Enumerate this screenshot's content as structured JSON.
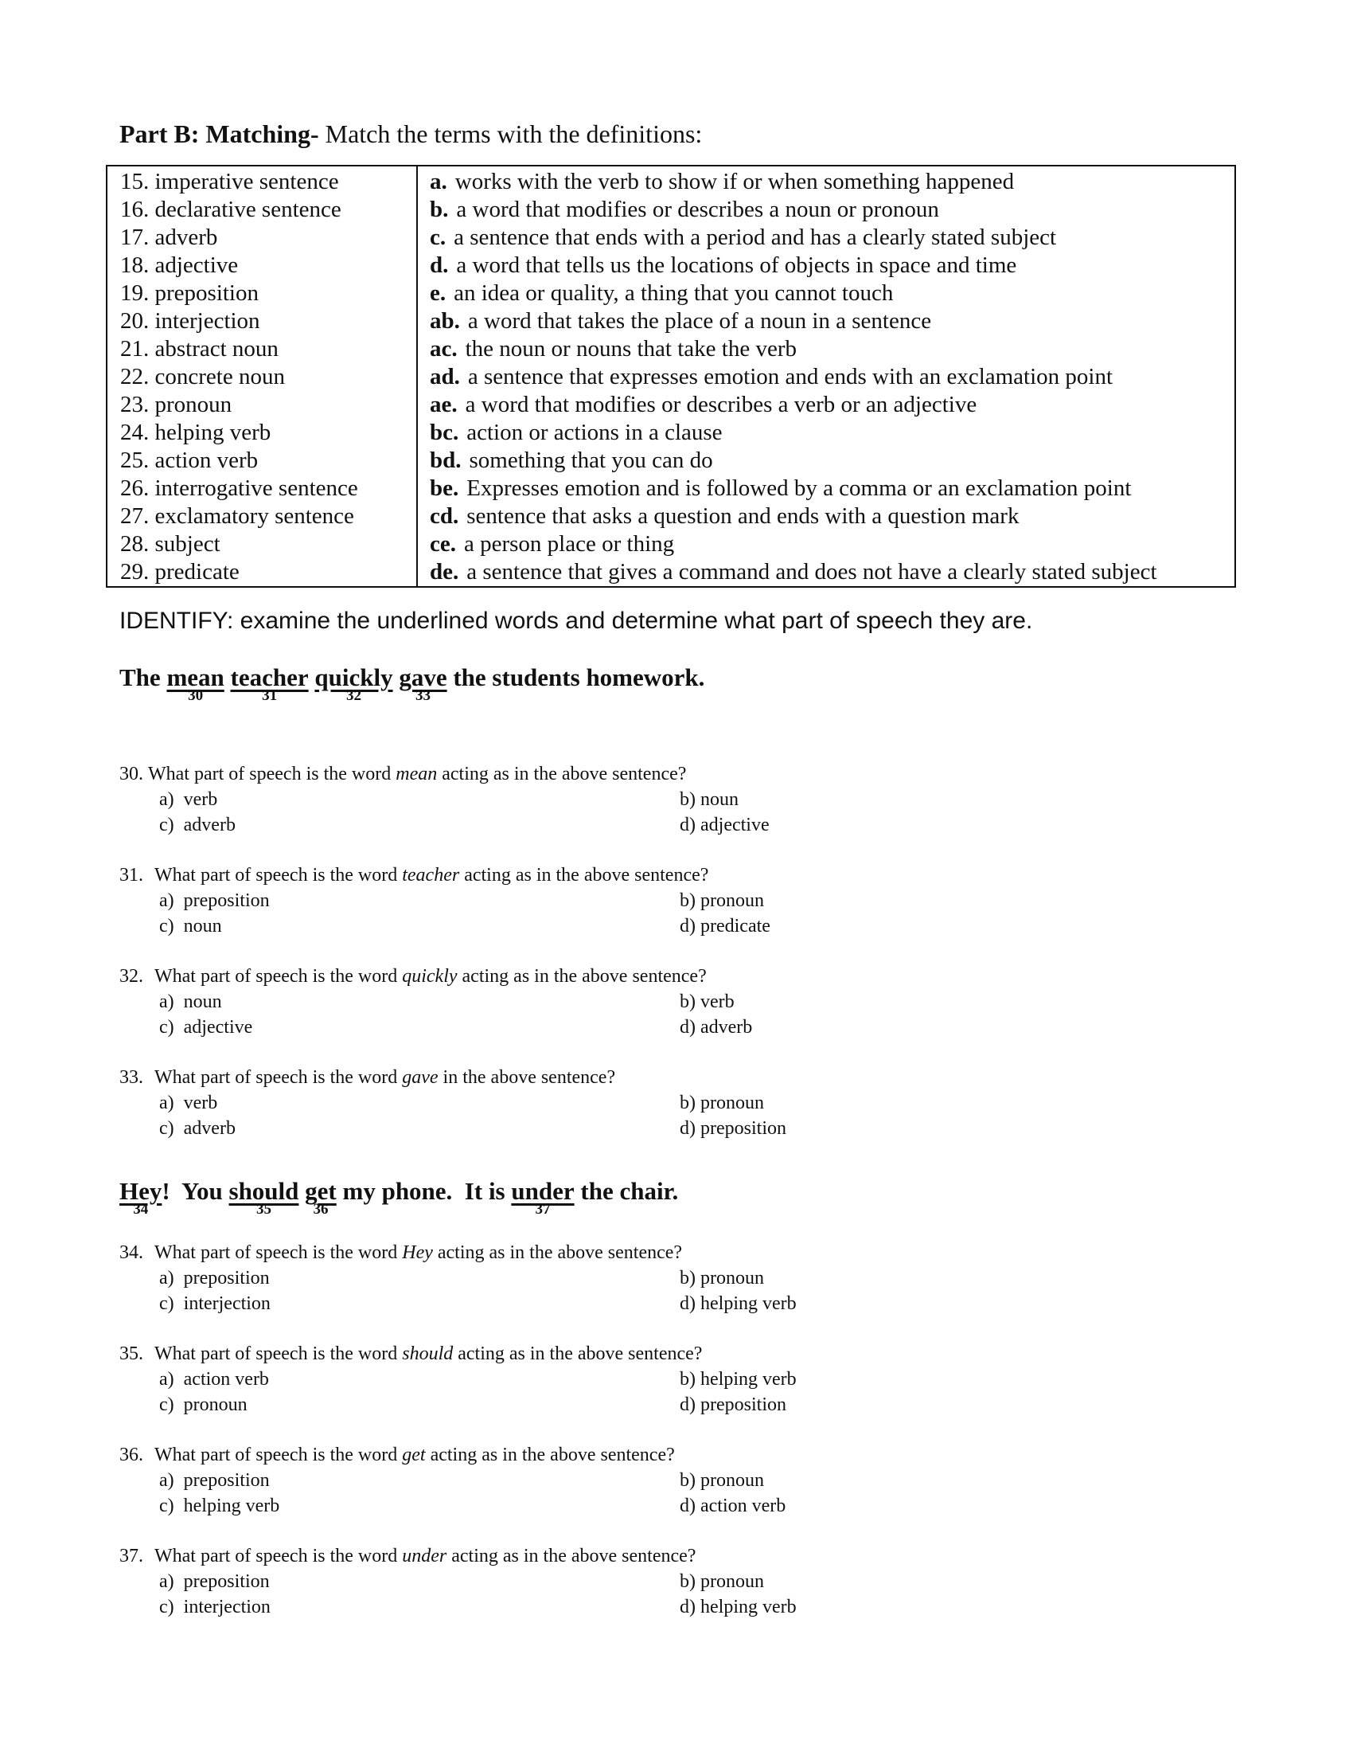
{
  "heading": {
    "bold": "Part B: Matching-",
    "rest": " Match the terms with the definitions:"
  },
  "matching": {
    "terms": [
      "15. imperative sentence",
      "16. declarative sentence",
      "17. adverb",
      "18. adjective",
      "19. preposition",
      "20. interjection",
      "21. abstract noun",
      "22. concrete noun",
      "23. pronoun",
      "24. helping verb",
      "25. action verb",
      "26. interrogative sentence",
      "27. exclamatory sentence",
      "28. subject",
      "29. predicate"
    ],
    "definitions": [
      {
        "letter": "a.",
        "text": "works with the verb to show if or when something happened"
      },
      {
        "letter": "b.",
        "text": "a word that modifies or describes a noun or pronoun"
      },
      {
        "letter": "c.",
        "text": "a sentence that ends with a period and has a clearly stated subject"
      },
      {
        "letter": "d.",
        "text": "a word that tells us the locations of objects in space and time"
      },
      {
        "letter": "e.",
        "text": "an idea or quality, a thing that you cannot touch"
      },
      {
        "letter": "ab.",
        "text": "a word that takes the place of a noun in a sentence"
      },
      {
        "letter": "ac.",
        "text": "the noun or nouns that take the verb"
      },
      {
        "letter": "ad.",
        "text": "a sentence that expresses emotion and ends with an exclamation point"
      },
      {
        "letter": "ae.",
        "text": "a word that modifies or describes a verb or an adjective"
      },
      {
        "letter": "bc.",
        "text": "action or actions in a clause"
      },
      {
        "letter": "bd.",
        "text": "something that you can do"
      },
      {
        "letter": "be.",
        "text": "Expresses emotion and is followed by a comma or an exclamation point"
      },
      {
        "letter": "cd.",
        "text": "sentence that asks a question and ends with a question mark"
      },
      {
        "letter": "ce.",
        "text": "a person place or thing"
      },
      {
        "letter": "de.",
        "text": "a sentence that gives a command and does not have a clearly stated subject"
      }
    ]
  },
  "identify": "IDENTIFY: examine the underlined words and determine what part of speech they are.",
  "sentence1": {
    "parts": [
      {
        "text": "The ",
        "u": false
      },
      {
        "text": "mean",
        "u": true,
        "num": "30"
      },
      {
        "text": " ",
        "u": false
      },
      {
        "text": "teacher",
        "u": true,
        "num": "31"
      },
      {
        "text": " ",
        "u": false
      },
      {
        "text": "quickly",
        "u": true,
        "num": "32"
      },
      {
        "text": " ",
        "u": false
      },
      {
        "text": "gave",
        "u": true,
        "num": "33"
      },
      {
        "text": " the students homework.",
        "u": false
      }
    ]
  },
  "sentence2": {
    "parts": [
      {
        "text": "Hey",
        "u": true,
        "num": "34"
      },
      {
        "text": "!  You ",
        "u": false
      },
      {
        "text": "should",
        "u": true,
        "num": "35"
      },
      {
        "text": " ",
        "u": false
      },
      {
        "text": "get",
        "u": true,
        "num": "36"
      },
      {
        "text": " my phone.  It is ",
        "u": false
      },
      {
        "text": "under",
        "u": true,
        "num": "37"
      },
      {
        "text": " the chair.",
        "u": false
      }
    ]
  },
  "questions": [
    {
      "num": "30.",
      "pre": "What part of speech is the word ",
      "word": "mean",
      "post": " acting as in the above sentence?",
      "options": [
        "a)  verb",
        "b) noun",
        "c)  adverb",
        "d) adjective"
      ]
    },
    {
      "num": "31.",
      "pre": "What part of speech is the word ",
      "word": "teacher",
      "post": " acting as in the above sentence?",
      "options": [
        "a)  preposition",
        "b) pronoun",
        "c)  noun",
        "d) predicate"
      ]
    },
    {
      "num": "32.",
      "pre": "What part of speech is the word ",
      "word": "quickly",
      "post": " acting as in the above sentence?",
      "options": [
        "a)  noun",
        "b) verb",
        "c)  adjective",
        "d) adverb"
      ]
    },
    {
      "num": "33.",
      "pre": "What part of speech is the word ",
      "word": "gave",
      "post": " in the above sentence?",
      "options": [
        "a)  verb",
        "b) pronoun",
        "c)  adverb",
        "d) preposition"
      ]
    },
    {
      "num": "34.",
      "pre": "What part of speech is the word ",
      "word": "Hey",
      "post": " acting as in the above sentence?",
      "options": [
        "a)  preposition",
        "b) pronoun",
        "c)  interjection",
        "d) helping verb"
      ]
    },
    {
      "num": "35.",
      "pre": "What part of speech is the word ",
      "word": "should",
      "post": " acting as in the above sentence?",
      "options": [
        "a)  action verb",
        "b) helping verb",
        "c)  pronoun",
        "d) preposition"
      ]
    },
    {
      "num": "36.",
      "pre": "What part of speech is the word ",
      "word": "get",
      "post": " acting as in the above sentence?",
      "options": [
        "a)  preposition",
        "b) pronoun",
        "c)  helping verb",
        "d) action verb"
      ]
    },
    {
      "num": "37.",
      "pre": "What part of speech is the word ",
      "word": "under",
      "post": " acting as in the above sentence?",
      "options": [
        "a)  preposition",
        "b) pronoun",
        "c)  interjection",
        "d) helping verb"
      ]
    }
  ]
}
